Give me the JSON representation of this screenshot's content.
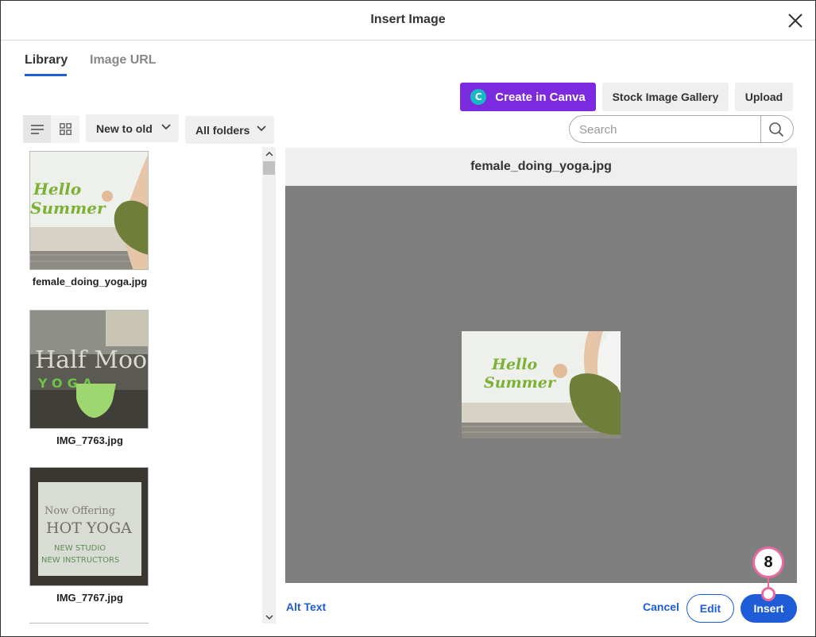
{
  "dialog": {
    "title": "Insert Image"
  },
  "tabs": [
    {
      "label": "Library",
      "active": true
    },
    {
      "label": "Image URL",
      "active": false
    }
  ],
  "toolbar": {
    "canva_label": "Create in Canva",
    "canva_badge": "C",
    "stock_label": "Stock Image Gallery",
    "upload_label": "Upload"
  },
  "filters": {
    "sort_value": "New to old",
    "folder_value": "All folders"
  },
  "search": {
    "placeholder": "Search"
  },
  "files": [
    {
      "name": "female_doing_yoga.jpg",
      "thumb_text": [
        "Hello",
        "Summer"
      ]
    },
    {
      "name": "IMG_7763.jpg",
      "thumb_text": [
        "Half Moon",
        "YOGA"
      ]
    },
    {
      "name": "IMG_7767.jpg",
      "thumb_text": [
        "Now Offering",
        "HOT YOGA",
        "NEW STUDIO",
        "NEW INSTRUCTORS"
      ]
    }
  ],
  "preview": {
    "filename": "female_doing_yoga.jpg",
    "image_text": [
      "Hello",
      "Summer"
    ]
  },
  "footer": {
    "alt_text_label": "Alt Text",
    "cancel_label": "Cancel",
    "edit_label": "Edit",
    "insert_label": "Insert"
  },
  "annotation": {
    "step": "8",
    "color": "#e86aa0"
  },
  "colors": {
    "accent": "#1e5cd8",
    "canva": "#7b2ae0",
    "canva_badge": "#16b9c6"
  },
  "icons": [
    "close-icon",
    "list-view-icon",
    "grid-view-icon",
    "chevron-down-icon",
    "search-icon",
    "scroll-up-arrow-icon",
    "scroll-down-arrow-icon"
  ]
}
